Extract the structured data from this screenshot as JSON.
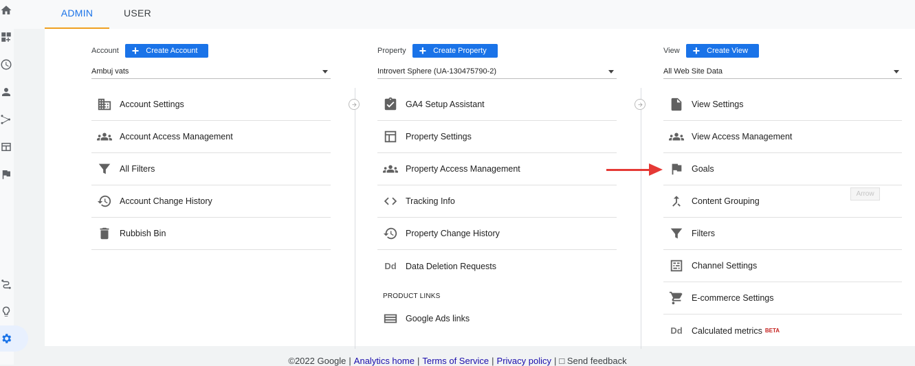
{
  "tabs": {
    "admin": "ADMIN",
    "user": "USER"
  },
  "rail": {
    "icons": [
      "home-icon",
      "dashboard-customize-icon",
      "clock-icon",
      "person-icon",
      "acquisition-icon",
      "behavior-icon",
      "flag-icon",
      "attribution-icon",
      "lightbulb-icon",
      "gear-icon"
    ]
  },
  "account": {
    "label": "Account",
    "create_label": "Create Account",
    "selected": "Ambuj vats",
    "items": [
      "Account Settings",
      "Account Access Management",
      "All Filters",
      "Account Change History",
      "Rubbish Bin"
    ]
  },
  "property": {
    "label": "Property",
    "create_label": "Create Property",
    "selected": "Introvert Sphere (UA-130475790-2)",
    "items": [
      "GA4 Setup Assistant",
      "Property Settings",
      "Property Access Management",
      "Tracking Info",
      "Property Change History",
      "Data Deletion Requests"
    ],
    "product_links_label": "PRODUCT LINKS",
    "product_links": [
      "Google Ads links"
    ]
  },
  "view": {
    "label": "View",
    "create_label": "Create View",
    "selected": "All Web Site Data",
    "items": [
      "View Settings",
      "View Access Management",
      "Goals",
      "Content Grouping",
      "Filters",
      "Channel Settings",
      "E-commerce Settings",
      "Calculated metrics"
    ],
    "beta": "BETA"
  },
  "annotation": {
    "tooltip": "Arrow"
  },
  "footer": {
    "copyright": "©2022 Google",
    "links": [
      "Analytics home",
      "Terms of Service",
      "Privacy policy"
    ],
    "feedback": "Send feedback"
  },
  "colors": {
    "accent": "#1a73e8",
    "tab_underline": "#ef9f20",
    "arrow": "#e53935"
  }
}
